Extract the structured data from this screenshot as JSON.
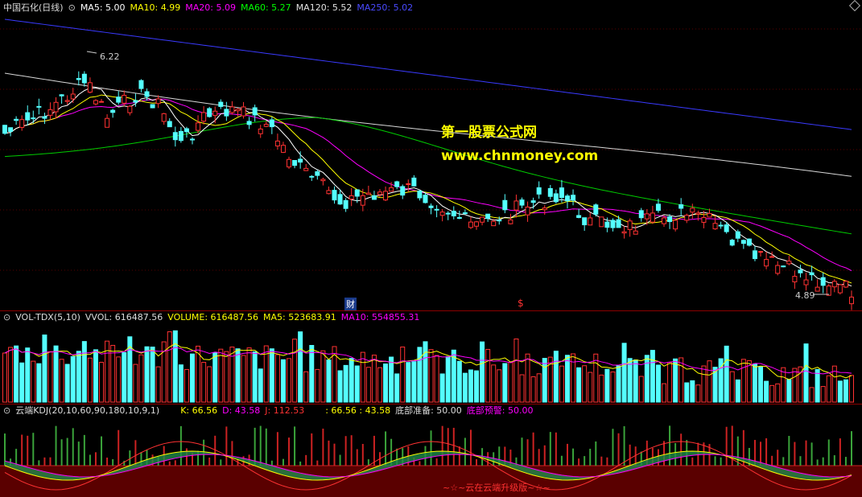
{
  "price": {
    "title": "中国石化(日线)",
    "ma": [
      {
        "label": "MA5: 5.00",
        "color": "#ffffff"
      },
      {
        "label": "MA10: 4.99",
        "color": "#ffff00"
      },
      {
        "label": "MA20: 5.09",
        "color": "#ff00ff"
      },
      {
        "label": "MA60: 5.27",
        "color": "#00ff00"
      },
      {
        "label": "MA120: 5.52",
        "color": "#e0e0e0"
      },
      {
        "label": "MA250: 5.02",
        "color": "#3a3aff"
      }
    ],
    "high_label": "6.22",
    "low_label": "4.89",
    "marker_cai": "财",
    "marker_s": "$",
    "watermark1": "第一股票公式网",
    "watermark2": "www.chnmoney.com"
  },
  "volume": {
    "title": "VOL-TDX(5,10)",
    "vvol": "VVOL: 616487.56",
    "volume": "VOLUME: 616487.56",
    "ma5": "MA5: 523683.91",
    "ma10": "MA10: 554855.31"
  },
  "kdj": {
    "title": "云端KDJ(20,10,60,90,180,10,9,1)",
    "k": "K: 66.56",
    "d": "D: 43.58",
    "j": "J: 112.53",
    "extra": ": 66.56 : 43.58",
    "bottom_prep": "底部准备: 50.00",
    "bottom_warn": "底部预警: 50.00",
    "caption": "~☆~云在云端升级版~☆~"
  },
  "colors": {
    "up": "#ff3232",
    "down": "#54ffff",
    "border": "#8b0000"
  }
}
